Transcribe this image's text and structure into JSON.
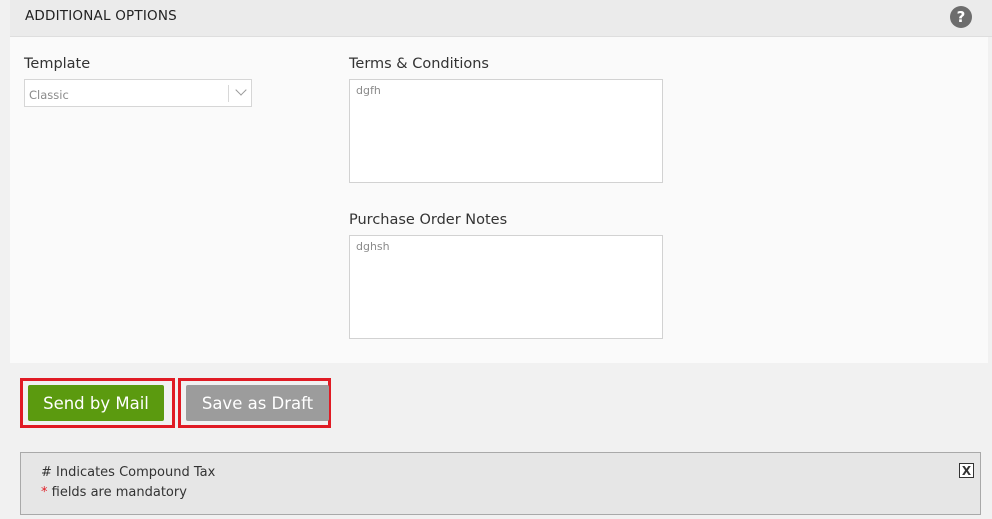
{
  "header": {
    "title": "ADDITIONAL OPTIONS",
    "help_icon": "question-circle-icon"
  },
  "template": {
    "label": "Template",
    "value": "Classic"
  },
  "terms": {
    "label": "Terms & Conditions",
    "value": "dgfh"
  },
  "po_notes": {
    "label": "Purchase Order Notes",
    "value": "dghsh"
  },
  "buttons": {
    "send": "Send by Mail",
    "draft": "Save as Draft"
  },
  "notice": {
    "compound": "# Indicates Compound Tax",
    "star": "*",
    "mandatory": " fields are mandatory",
    "close": "X"
  },
  "colors": {
    "send_button": "#5b9a0f",
    "draft_button": "#9c9c9c",
    "highlight_border": "#e01b24"
  }
}
